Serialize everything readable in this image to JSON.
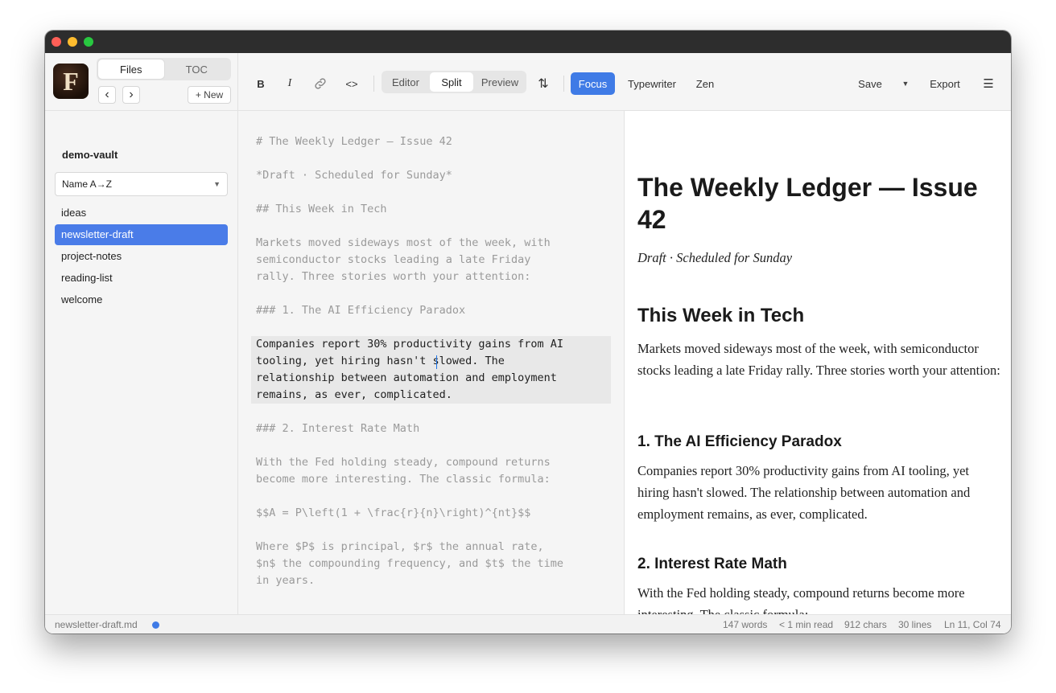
{
  "sidebar": {
    "logo_letter": "F",
    "tabs": [
      {
        "label": "Files"
      },
      {
        "label": "TOC"
      }
    ],
    "back_label": "‹",
    "forward_label": "›",
    "new_label": "+ New",
    "vault_name": "demo-vault",
    "sort": {
      "selected": "Name A→Z",
      "caret": "▼"
    },
    "files": [
      {
        "label": "ideas",
        "active": false
      },
      {
        "label": "newsletter-draft",
        "active": true
      },
      {
        "label": "project-notes",
        "active": false
      },
      {
        "label": "reading-list",
        "active": false
      },
      {
        "label": "welcome",
        "active": false
      }
    ]
  },
  "toolbar": {
    "bold": "B",
    "italic": "I",
    "code": "<>",
    "views": [
      {
        "label": "Editor"
      },
      {
        "label": "Split",
        "active": true
      },
      {
        "label": "Preview"
      }
    ],
    "swap": "⇅",
    "modes": [
      {
        "label": "Focus",
        "active": true
      },
      {
        "label": "Typewriter"
      },
      {
        "label": "Zen"
      }
    ],
    "save": "Save",
    "save_caret": "▼",
    "export": "Export",
    "menu": "☰",
    "accent_color": "#3f7be6"
  },
  "editor": {
    "lines": [
      "# The Weekly Ledger — Issue 42",
      "*Draft · Scheduled for Sunday*",
      "## This Week in Tech",
      "Markets moved sideways most of the week, with\nsemiconductor stocks leading a late Friday\nrally. Three stories worth your attention:",
      "### 1. The AI Efficiency Paradox",
      "Companies report 30% productivity gains from AI\ntooling, yet hiring hasn't slowed. The\nrelationship between automation and employment\nremains, as ever, complicated.",
      "### 2. Interest Rate Math",
      "With the Fed holding steady, compound returns\nbecome more interesting. The classic formula:",
      "$$A = P\\left(1 + \\frac{r}{n}\\right)^{nt}$$",
      "Where $P$ is principal, $r$ the annual rate,\n$n$ the compounding frequency, and $t$ the time\nin years."
    ]
  },
  "preview": {
    "h1": "The Weekly Ledger — Issue 42",
    "subtitle": "Draft · Scheduled for Sunday",
    "h2": "This Week in Tech",
    "intro": "Markets moved sideways most of the week, with semiconductor stocks leading a late Friday rally. Three stories worth your attention:",
    "h3_1": "1. The AI Efficiency Paradox",
    "p1": "Companies report 30% productivity gains from AI tooling, yet hiring hasn't slowed. The relationship between automation and employment remains, as ever, complicated.",
    "h3_2": "2. Interest Rate Math",
    "p2": "With the Fed holding steady, compound returns become more interesting. The classic formula:"
  },
  "status": {
    "filename": "newsletter-draft.md",
    "words": "147 words",
    "read_time": "< 1 min read",
    "chars": "912 chars",
    "lines": "30 lines",
    "position": "Ln 11, Col 74"
  }
}
